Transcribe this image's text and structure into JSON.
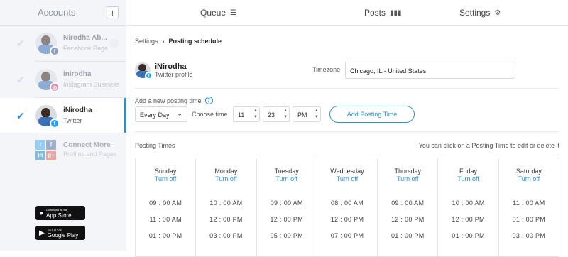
{
  "sidebar": {
    "title": "Accounts",
    "add_label": "+",
    "accounts": [
      {
        "name": "Nirodha Ab...",
        "type": "Facebook Page",
        "badge": "f"
      },
      {
        "name": "inirodha",
        "type": "Instagram Business",
        "badge": "◎"
      },
      {
        "name": "iNirodha",
        "type": "Twitter",
        "badge": "t"
      }
    ],
    "connect": {
      "title": "Connect More",
      "subtitle": "Profiles and Pages"
    },
    "app_store": {
      "small": "Download on the",
      "big": "App Store"
    },
    "google_play": {
      "small": "GET IT ON",
      "big": "Google Play"
    }
  },
  "nav": {
    "queue": "Queue",
    "posts": "Posts",
    "settings": "Settings"
  },
  "breadcrumb": {
    "root": "Settings",
    "separator": "›",
    "current": "Posting schedule"
  },
  "profile": {
    "name": "iNirodha",
    "type": "Twitter profile"
  },
  "timezone": {
    "label": "Timezone",
    "value": "Chicago, IL - United States"
  },
  "add_time": {
    "label": "Add a new posting time",
    "help": "?",
    "day": "Every Day",
    "choose_label": "Choose time",
    "hour": "11",
    "minute": "23",
    "ampm": "PM",
    "button": "Add Posting Time"
  },
  "posting_times": {
    "label": "Posting Times",
    "hint": "You can click on a Posting Time to edit or delete it",
    "days": [
      {
        "day": "Sunday",
        "toggle": "Turn off",
        "times": [
          "09 : 00  AM",
          "11 : 00  AM",
          "01 : 00  PM"
        ]
      },
      {
        "day": "Monday",
        "toggle": "Turn off",
        "times": [
          "10 : 00  AM",
          "12 : 00  PM",
          "03 : 00  PM"
        ]
      },
      {
        "day": "Tuesday",
        "toggle": "Turn off",
        "times": [
          "09 : 00  AM",
          "12 : 00  PM",
          "05 : 00  PM"
        ]
      },
      {
        "day": "Wednesday",
        "toggle": "Turn off",
        "times": [
          "08 : 00  AM",
          "12 : 00  PM",
          "07 : 00  PM"
        ]
      },
      {
        "day": "Thursday",
        "toggle": "Turn off",
        "times": [
          "09 : 00  AM",
          "12 : 00  PM",
          "01 : 00  PM"
        ]
      },
      {
        "day": "Friday",
        "toggle": "Turn off",
        "times": [
          "10 : 00  AM",
          "12 : 00  PM",
          "01 : 00  PM"
        ]
      },
      {
        "day": "Saturday",
        "toggle": "Turn off",
        "times": [
          "11 : 00  AM",
          "01 : 00  PM",
          "03 : 00  PM"
        ]
      }
    ]
  },
  "colors": {
    "accent": "#2d8fd5",
    "sidebar_bg": "#f3f5f8"
  }
}
